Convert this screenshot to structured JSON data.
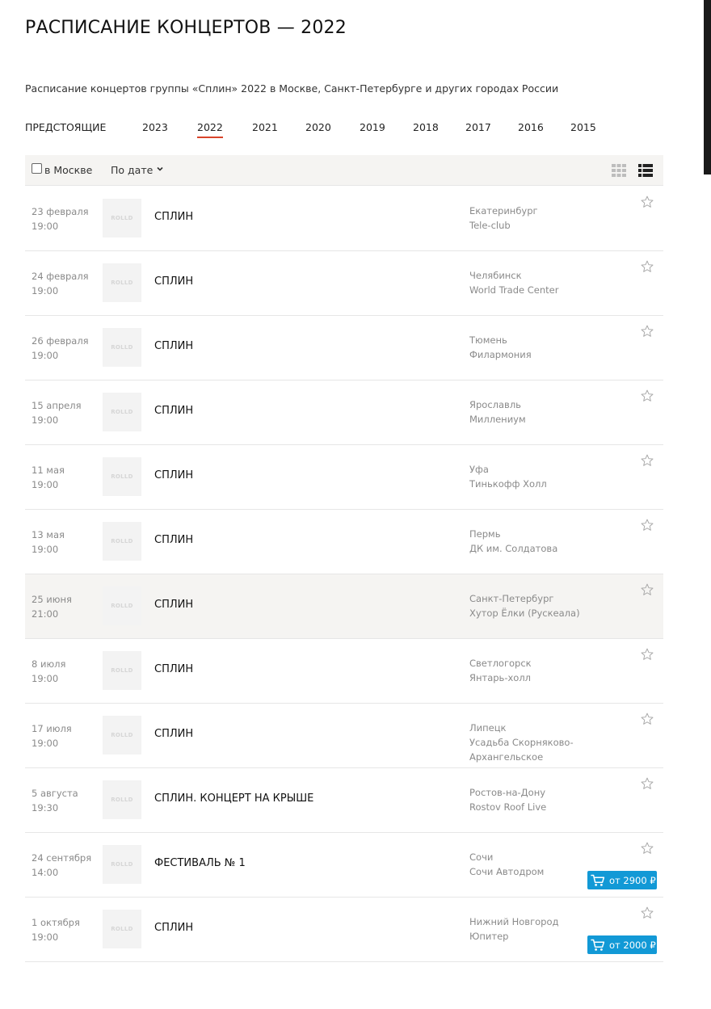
{
  "page": {
    "title": "РАСПИСАНИЕ КОНЦЕРТОВ — 2022",
    "subtitle": "Расписание концертов группы «Сплин» 2022 в Москве, Санкт-Петербурге и других городах России"
  },
  "year_tabs": [
    {
      "label": "ПРЕДСТОЯЩИЕ",
      "active": false
    },
    {
      "label": "2023",
      "active": false
    },
    {
      "label": "2022",
      "active": true
    },
    {
      "label": "2021",
      "active": false
    },
    {
      "label": "2020",
      "active": false
    },
    {
      "label": "2019",
      "active": false
    },
    {
      "label": "2018",
      "active": false
    },
    {
      "label": "2017",
      "active": false
    },
    {
      "label": "2016",
      "active": false
    },
    {
      "label": "2015",
      "active": false
    }
  ],
  "filters": {
    "moscow_label": "в Москве",
    "moscow_checked": false,
    "sort_label": "По дате"
  },
  "colors": {
    "accent": "#d9442a",
    "ticket_button": "#1299d6",
    "row_highlight": "#f5f4f2"
  },
  "concerts": [
    {
      "date": "23 февраля",
      "time": "19:00",
      "thumb": "ROLLD",
      "title": "СПЛИН",
      "city": "Екатеринбург",
      "venue": "Tele-club",
      "ticket": ""
    },
    {
      "date": "24 февраля",
      "time": "19:00",
      "thumb": "ROLLD",
      "title": "СПЛИН",
      "city": "Челябинск",
      "venue": "World Trade Center",
      "ticket": ""
    },
    {
      "date": "26 февраля",
      "time": "19:00",
      "thumb": "ROLLD",
      "title": "СПЛИН",
      "city": "Тюмень",
      "venue": "Филармония",
      "ticket": ""
    },
    {
      "date": "15 апреля",
      "time": "19:00",
      "thumb": "ROLLD",
      "title": "СПЛИН",
      "city": "Ярославль",
      "venue": "Миллениум",
      "ticket": ""
    },
    {
      "date": "11 мая",
      "time": "19:00",
      "thumb": "ROLLD",
      "title": "СПЛИН",
      "city": "Уфа",
      "venue": "Тинькофф Холл",
      "ticket": ""
    },
    {
      "date": "13 мая",
      "time": "19:00",
      "thumb": "ROLLD",
      "title": "СПЛИН",
      "city": "Пермь",
      "venue": "ДК им. Солдатова",
      "ticket": ""
    },
    {
      "date": "25 июня",
      "time": "21:00",
      "thumb": "ROLLD",
      "title": "СПЛИН",
      "city": "Санкт-Петербург",
      "venue": "Хутор Ёлки (Рускеала)",
      "ticket": "",
      "highlighted": true
    },
    {
      "date": "8 июля",
      "time": "19:00",
      "thumb": "ROLLD",
      "title": "СПЛИН",
      "city": "Светлогорск",
      "venue": "Янтарь-холл",
      "ticket": ""
    },
    {
      "date": "17 июля",
      "time": "19:00",
      "thumb": "ROLLD",
      "title": "СПЛИН",
      "city": "Липецк",
      "venue": "Усадьба Скорняково-Архангельское",
      "ticket": ""
    },
    {
      "date": "5 августа",
      "time": "19:30",
      "thumb": "ROLLD",
      "title": "СПЛИН. КОНЦЕРТ НА КРЫШЕ",
      "city": "Ростов-на-Дону",
      "venue": "Rostov Roof Live",
      "ticket": ""
    },
    {
      "date": "24 сентября",
      "time": "14:00",
      "thumb": "ROLLD",
      "title": "ФЕСТИВАЛЬ № 1",
      "city": "Сочи",
      "venue": "Сочи Автодром",
      "ticket": "от 2900 ₽"
    },
    {
      "date": "1 октября",
      "time": "19:00",
      "thumb": "ROLLD",
      "title": "СПЛИН",
      "city": "Нижний Новгород",
      "venue": "Юпитер",
      "ticket": "от 2000 ₽"
    }
  ]
}
